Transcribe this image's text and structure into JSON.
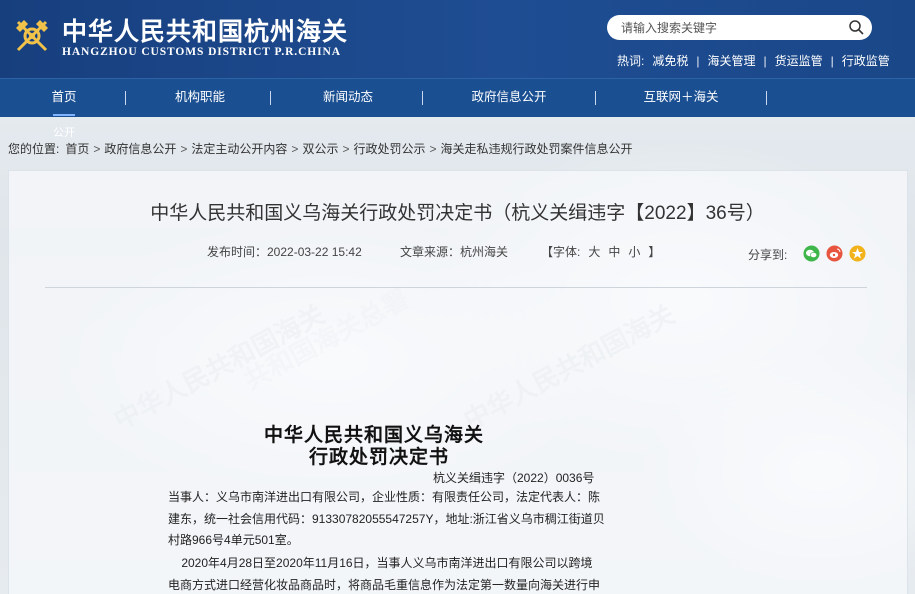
{
  "header": {
    "site_name_cn": "中华人民共和国杭州海关",
    "site_name_en": "HANGZHOU CUSTOMS DISTRICT P.R.CHINA",
    "search_placeholder": "请输入搜索关键字",
    "hot_label": "热词:",
    "hot_words": [
      "减免税",
      "海关管理",
      "货运监管",
      "行政监管"
    ]
  },
  "nav": {
    "items": [
      "首页",
      "机构职能",
      "新闻动态",
      "政府信息公开",
      "互联网＋海关"
    ],
    "extra_text": "公开",
    "sep_char": "|"
  },
  "breadcrumb": {
    "prefix": "您的位置:",
    "items": [
      "首页",
      "政府信息公开",
      "法定主动公开内容",
      "双公示",
      "行政处罚公示",
      "海关走私违规行政处罚案件信息公开"
    ],
    "sep": ">"
  },
  "article": {
    "title": "中华人民共和国义乌海关行政处罚决定书（杭义关缉违字【2022】36号）",
    "publish_time": "发布时间：2022-03-22 15:42",
    "source": "文章来源：杭州海关",
    "font_label_open": "【字体:",
    "font_sizes": [
      "大",
      "中",
      "小"
    ],
    "font_label_close": "】",
    "share_label": "分享到:"
  },
  "document": {
    "title_line1": "中华人民共和国义乌海关",
    "title_line2": "行政处罚决定书",
    "doc_number": "杭义关缉违字（2022）0036号",
    "party_lines": [
      "当事人：义乌市南洋进出口有限公司，企业性质：有限责任公司，法定代表人：陈",
      "建东，统一社会信用代码：91330782055547257Y，地址:浙江省义乌市稠江街道贝",
      "村路966号4单元501室。"
    ],
    "body_lines": [
      "    2020年4月28日至2020年11月16日，当事人义乌市南洋进出口有限公司以跨境",
      "电商方式进口经营化妆品商品时，将商品毛重信息作为法定第一数量向海关进行申"
    ]
  },
  "colors": {
    "header_bg": "#1f4d93",
    "nav_bg": "#1a4f92",
    "wechat": "#3fb64a",
    "weibo": "#e8553f",
    "qzone": "#f2b21b"
  }
}
